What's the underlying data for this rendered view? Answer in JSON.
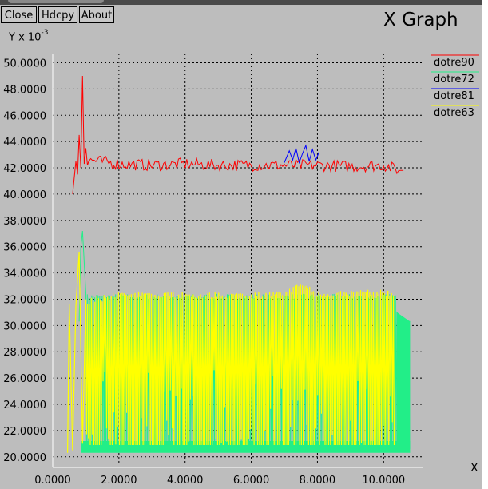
{
  "window": {
    "buttons": {
      "close": "Close",
      "hdcpy": "Hdcpy",
      "about": "About"
    },
    "title": "X Graph",
    "corner_mark": "X"
  },
  "chart_data": {
    "type": "line",
    "ylabel_prefix": "Y x 10",
    "ylabel_exponent": "-3",
    "xlim": [
      0,
      11.2
    ],
    "ylim": [
      19.5,
      50.7
    ],
    "grid": true,
    "legend_position": "top-right",
    "x_ticks": [
      "0.0000",
      "2.0000",
      "4.0000",
      "6.0000",
      "8.0000",
      "10.0000"
    ],
    "x_tick_values": [
      0,
      2,
      4,
      6,
      8,
      10
    ],
    "y_ticks": [
      "20.0000",
      "22.0000",
      "24.0000",
      "26.0000",
      "28.0000",
      "30.0000",
      "32.0000",
      "34.0000",
      "36.0000",
      "38.0000",
      "40.0000",
      "42.0000",
      "44.0000",
      "46.0000",
      "48.0000",
      "50.0000"
    ],
    "y_tick_values": [
      20,
      22,
      24,
      26,
      28,
      30,
      32,
      34,
      36,
      38,
      40,
      42,
      44,
      46,
      48,
      50
    ],
    "series": [
      {
        "name": "dotre90",
        "color": "#ff0000",
        "x": [
          0.6,
          0.7,
          0.75,
          0.8,
          0.85,
          0.9,
          0.95,
          1.0,
          1.05,
          1.1,
          2,
          3,
          4,
          5,
          6,
          7,
          8,
          9,
          10,
          10.5,
          10.6
        ],
        "y": [
          40.0,
          42.5,
          41.5,
          44.5,
          42.0,
          49.0,
          42.3,
          43.5,
          42.2,
          42.6,
          42.3,
          42.2,
          42.3,
          42.2,
          42.2,
          42.2,
          42.2,
          42.1,
          42.2,
          41.8,
          41.8
        ]
      },
      {
        "name": "dotre72",
        "color": "#22ee88",
        "x": [
          0.55,
          0.8,
          0.85,
          0.9,
          1.0,
          2,
          4,
          6,
          8,
          10,
          10.4,
          10.6,
          10.8
        ],
        "y": [
          30.3,
          30.3,
          36.0,
          37.2,
          32.5,
          20.6,
          20.6,
          20.6,
          20.6,
          20.6,
          31.0,
          30.4,
          30.3
        ]
      },
      {
        "name": "dotre81",
        "color": "#0000ff",
        "x": [
          7.0,
          7.15,
          7.25,
          7.35,
          7.45,
          7.55,
          7.65,
          7.75,
          7.85,
          7.95,
          8.05
        ],
        "y": [
          42.4,
          43.3,
          42.6,
          43.5,
          42.4,
          43.1,
          43.7,
          42.5,
          43.4,
          42.6,
          43.2
        ]
      },
      {
        "name": "dotre63",
        "color": "#ffff00",
        "x": [
          0.45,
          0.5,
          0.6,
          0.8,
          0.9,
          1.0,
          2,
          4,
          6,
          7,
          7.5,
          8,
          10,
          10.3
        ],
        "y": [
          20.3,
          31.6,
          20.5,
          35.6,
          21.0,
          31.8,
          32.3,
          32.3,
          32.3,
          32.4,
          33.1,
          32.4,
          32.5,
          32.5
        ]
      }
    ]
  }
}
